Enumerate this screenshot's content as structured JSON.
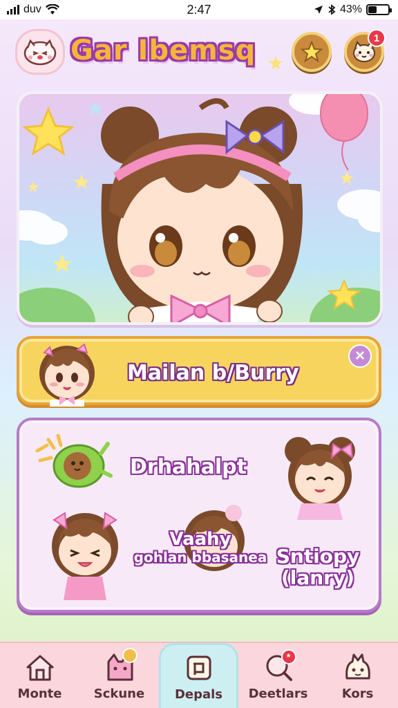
{
  "status_bar": {
    "carrier": "duv",
    "time": "2:47",
    "battery_text": "43%",
    "battery_level": 0.43
  },
  "header": {
    "title": "Gar Ibemsq",
    "notification_count": "1"
  },
  "banner": {
    "title": "Mailan b/Burry",
    "close_symbol": "×"
  },
  "panel": {
    "title": "Drhahalpt",
    "item_center_line1": "Vaahy",
    "item_center_line2": "gohlan bbasanea",
    "item_right_line1": "Sntiopy",
    "item_right_line2": "(lanry)"
  },
  "bottom_nav": {
    "items": [
      {
        "label": "Monte",
        "icon": "home-icon"
      },
      {
        "label": "Sckune",
        "icon": "cat-icon"
      },
      {
        "label": "Depals",
        "icon": "deals-icon",
        "active": true
      },
      {
        "label": "Deetlars",
        "icon": "search-icon",
        "badge": "*"
      },
      {
        "label": "Kors",
        "icon": "creature-icon"
      }
    ]
  },
  "colors": {
    "accent_purple": "#9b3aa8",
    "title_yellow": "#f4b63a",
    "banner_yellow": "#f7d45e",
    "nav_pink": "#fbd6dd",
    "nav_active": "#cdeff2",
    "badge_red": "#e8384a"
  }
}
